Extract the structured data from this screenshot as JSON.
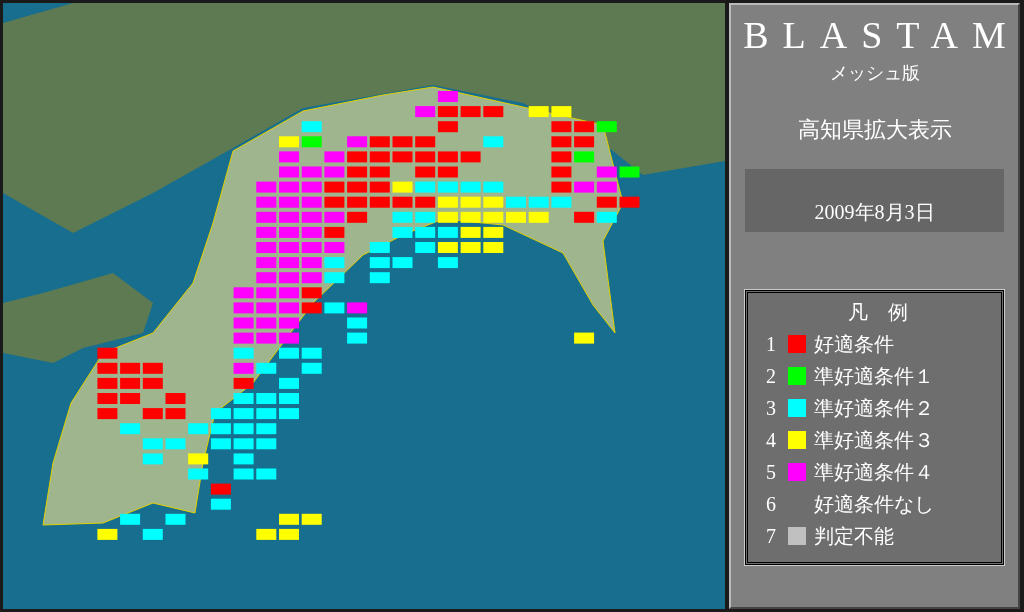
{
  "panel": {
    "title": "BLASTAM",
    "subtitle": "メッシュ版",
    "view": "高知県拡大表示",
    "date": "2009年8月3日"
  },
  "legend": {
    "title": "凡　例",
    "items": [
      {
        "number": "1",
        "label": "好適条件",
        "color": "#ff0000"
      },
      {
        "number": "2",
        "label": "準好適条件１",
        "color": "#00ff00"
      },
      {
        "number": "3",
        "label": "準好適条件２",
        "color": "#00ffff"
      },
      {
        "number": "4",
        "label": "準好適条件３",
        "color": "#ffff00"
      },
      {
        "number": "5",
        "label": "準好適条件４",
        "color": "#ff00ff"
      },
      {
        "number": "6",
        "label": "好適条件なし"
      },
      {
        "number": "7",
        "label": "判定不能",
        "color": "#c0c0c0"
      }
    ]
  }
}
